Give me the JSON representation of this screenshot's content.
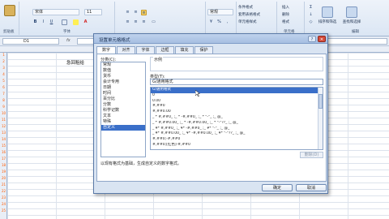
{
  "ribbon": {
    "font_name": "宋体",
    "font_size": "11",
    "number_format": "常规",
    "groups": {
      "clipboard": "剪贴板",
      "font": "字体",
      "cells": "单元格",
      "editing": "编辑"
    },
    "style_buttons": [
      "条件格式",
      "套用表格格式",
      "单元格样式"
    ],
    "cell_buttons": [
      "插入",
      "删除",
      "格式"
    ],
    "big_buttons": [
      "排序和筛选",
      "查找和选择"
    ]
  },
  "formula_bar": {
    "name_box": "D1",
    "fx": "fx"
  },
  "sheet": {
    "rows": [
      "1",
      "2",
      "3",
      "4",
      "5",
      "6",
      "7",
      "8",
      "9",
      "10",
      "11",
      "12",
      "13",
      "14",
      "15",
      "16",
      "17",
      "18",
      "19",
      "20",
      "21",
      "22",
      "23",
      "24",
      "25"
    ],
    "cell_text": "急回租给"
  },
  "dialog": {
    "title": "设置单元格格式",
    "tabs": [
      "数字",
      "对齐",
      "字体",
      "边框",
      "填充",
      "保护"
    ],
    "category_label": "分类(C):",
    "categories": [
      "常规",
      "数值",
      "货币",
      "会计专用",
      "日期",
      "时间",
      "百分比",
      "分数",
      "科学记数",
      "文本",
      "特殊",
      "自定义"
    ],
    "selected_category": "自定义",
    "sample_label": "示例",
    "type_label": "类型(T):",
    "type_value": "G/通用格式",
    "formats": [
      "G/通用格式",
      "0",
      "0.00",
      "#,##0",
      "#,##0.00",
      "_ * #,##0_ ;_ * -#,##0_ ;_ * \"-\"_ ;_ @_",
      "_ * #,##0.00_ ;_ * -#,##0.00_ ;_ * \"-\"??_ ;_ @_",
      "_ ¥* #,##0_ ;_ ¥* -#,##0_ ;_ ¥* \"-\"_ ;_ @_",
      "_ ¥* #,##0.00_ ;_ ¥* -#,##0.00_ ;_ ¥* \"-\"??_ ;_ @_",
      "#,##0;-#,##0",
      "#,##0;[红色]-#,##0"
    ],
    "selected_format": "G/通用格式",
    "delete_label": "删除(D)",
    "description": "以现有格式为基础，生成自定义的数字格式。",
    "ok_label": "确定",
    "cancel_label": "取消"
  }
}
